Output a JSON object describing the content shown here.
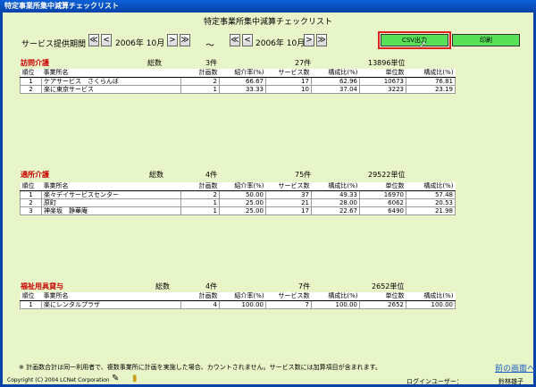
{
  "window": {
    "title": "特定事業所集中減算チェックリスト"
  },
  "page": {
    "title": "特定事業所集中減算チェックリスト"
  },
  "period": {
    "label": "サービス提供期間",
    "from": "2006年 10月",
    "to": "2006年 10月",
    "separator": "～",
    "first_glyph": "≪",
    "prev_glyph": "<",
    "next_glyph": ">",
    "last_glyph": "≫"
  },
  "actions": {
    "csv_label": "CSV出力",
    "print_label": "印刷"
  },
  "table_headers": [
    "順位",
    "事業所名",
    "計画数",
    "紹介率(%)",
    "サービス数",
    "構成比(%)",
    "単位数",
    "構成比(%)"
  ],
  "summary_label": "総数",
  "sections": [
    {
      "title": "訪問介護",
      "plan_total": "3件",
      "service_total": "27件",
      "unit_total": "13896単位",
      "rows": [
        {
          "rank": "1",
          "name": "ケアサービス　さくらんぼ",
          "plans": "2",
          "rate": "66.67",
          "services": "17",
          "ratio1": "62.96",
          "units": "10673",
          "ratio2": "76.81"
        },
        {
          "rank": "2",
          "name": "楽に東京サービス",
          "plans": "1",
          "rate": "33.33",
          "services": "10",
          "ratio1": "37.04",
          "units": "3223",
          "ratio2": "23.19"
        }
      ]
    },
    {
      "title": "通所介護",
      "plan_total": "4件",
      "service_total": "75件",
      "unit_total": "29522単位",
      "rows": [
        {
          "rank": "1",
          "name": "楽々デイサービスセンター",
          "plans": "2",
          "rate": "50.00",
          "services": "37",
          "ratio1": "49.33",
          "units": "16970",
          "ratio2": "57.48"
        },
        {
          "rank": "2",
          "name": "原町",
          "plans": "1",
          "rate": "25.00",
          "services": "21",
          "ratio1": "28.00",
          "units": "6062",
          "ratio2": "20.53"
        },
        {
          "rank": "3",
          "name": "神楽坂　静華庵",
          "plans": "1",
          "rate": "25.00",
          "services": "17",
          "ratio1": "22.67",
          "units": "6490",
          "ratio2": "21.98"
        }
      ]
    },
    {
      "title": "福祉用具貸与",
      "plan_total": "4件",
      "service_total": "7件",
      "unit_total": "2652単位",
      "rows": [
        {
          "rank": "1",
          "name": "楽にレンタルプラザ",
          "plans": "4",
          "rate": "100.00",
          "services": "7",
          "ratio1": "100.00",
          "units": "2652",
          "ratio2": "100.00"
        }
      ]
    }
  ],
  "footer": {
    "note": "※ 計画数合計は同一利用者で、複数事業所に計画を実施した場合、カウントされません。サービス数には加算項目が含まれます。",
    "back_link": "前の画面へ",
    "copyright": "Copyright (C) 2004 LCNet Corporation",
    "login_label": "ログインユーザー：",
    "login_user": "鈴林雄子"
  }
}
